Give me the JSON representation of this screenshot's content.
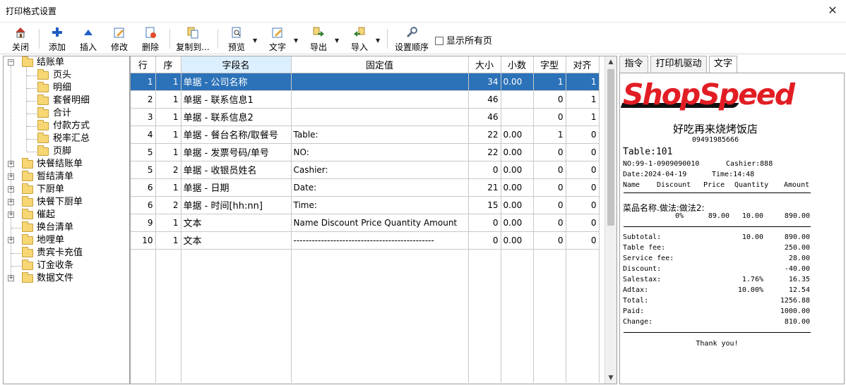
{
  "window": {
    "title": "打印格式设置"
  },
  "toolbar": {
    "close": "关闭",
    "add": "添加",
    "insert": "插入",
    "modify": "修改",
    "delete": "删除",
    "copy_to": "复制到...",
    "preview": "预览",
    "text": "文字",
    "export": "导出",
    "import": "导入",
    "set_order": "设置顺序",
    "show_all_pages": "显示所有页"
  },
  "tree": {
    "root": "结账单",
    "children": [
      "页头",
      "明细",
      "套餐明细",
      "合计",
      "付款方式",
      "税率汇总",
      "页脚"
    ],
    "others": [
      {
        "label": "快餐结账单",
        "expandable": true
      },
      {
        "label": "暂结清单",
        "expandable": true
      },
      {
        "label": "下厨单",
        "expandable": true
      },
      {
        "label": "快餐下厨单",
        "expandable": true
      },
      {
        "label": "催起",
        "expandable": true
      },
      {
        "label": "换台清单",
        "expandable": false
      },
      {
        "label": "地哩单",
        "expandable": true
      },
      {
        "label": "贵宾卡充值",
        "expandable": false
      },
      {
        "label": "订金收条",
        "expandable": false
      },
      {
        "label": "数据文件",
        "expandable": true
      }
    ]
  },
  "grid": {
    "headers": [
      "行",
      "序",
      "字段名",
      "固定值",
      "大小",
      "小数",
      "字型",
      "对齐"
    ],
    "rows": [
      [
        "1",
        "1",
        "单据 - 公司名称",
        "",
        "34",
        "0.00",
        "1",
        "1"
      ],
      [
        "2",
        "1",
        "单据 - 联系信息1",
        "",
        "46",
        "",
        "0",
        "1"
      ],
      [
        "3",
        "1",
        "单据 - 联系信息2",
        "",
        "46",
        "",
        "0",
        "1"
      ],
      [
        "4",
        "1",
        "单据 - 餐台名称/取餐号",
        "Table:",
        "22",
        "0.00",
        "1",
        "0"
      ],
      [
        "5",
        "1",
        "单据 - 发票号码/单号",
        "NO:",
        "22",
        "0.00",
        "0",
        "0"
      ],
      [
        "5",
        "2",
        "单据 - 收银员姓名",
        "Cashier:",
        "0",
        "0.00",
        "0",
        "0"
      ],
      [
        "6",
        "1",
        "单据 - 日期",
        "Date:",
        "21",
        "0.00",
        "0",
        "0"
      ],
      [
        "6",
        "2",
        "单据 - 时间[hh:nn]",
        "Time:",
        "15",
        "0.00",
        "0",
        "0"
      ],
      [
        "9",
        "1",
        "文本",
        "Name   Discount  Price  Quantity  Amount",
        "0",
        "0.00",
        "0",
        "0"
      ],
      [
        "10",
        "1",
        "文本",
        "----------------------------------------------",
        "0",
        "0.00",
        "0",
        "0"
      ]
    ]
  },
  "tabs": [
    "指令",
    "打印机驱动",
    "文字"
  ],
  "receipt": {
    "logo": "ShopSpeed",
    "shop_name": "好吃再来烧烤饭店",
    "phone": "09491985666",
    "table": "Table:101",
    "no": "NO:99-1-0909090010",
    "cashier": "Cashier:888",
    "date": "Date:2024-04-19",
    "time": "Time:14:48",
    "header_cols": [
      "Name",
      "Discount",
      "Price",
      "Quantity",
      "Amount"
    ],
    "item_name": "菜品名称.做法:做法2:",
    "item_vals": [
      "0%",
      "89.00",
      "10.00",
      "890.00"
    ],
    "totals": [
      {
        "label": "Subtotal:",
        "pct": "10.00",
        "val": "890.00"
      },
      {
        "label": "Table fee:",
        "pct": "",
        "val": "250.00"
      },
      {
        "label": "Service fee:",
        "pct": "",
        "val": "28.00"
      },
      {
        "label": "Discount:",
        "pct": "",
        "val": "-40.00"
      },
      {
        "label": "Salestax:",
        "pct": "1.76%",
        "val": "16.35"
      },
      {
        "label": "Adtax:",
        "pct": "10.00%",
        "val": "12.54"
      },
      {
        "label": "Total:",
        "pct": "",
        "val": "1256.88"
      },
      {
        "label": "Paid:",
        "pct": "",
        "val": "1000.00"
      },
      {
        "label": "Change:",
        "pct": "",
        "val": "810.00"
      }
    ],
    "thanks": "Thank you!"
  },
  "colors": {
    "selection": "#2c72b8",
    "header_highlight": "#dcefff",
    "logo_red": "#e21d24"
  }
}
